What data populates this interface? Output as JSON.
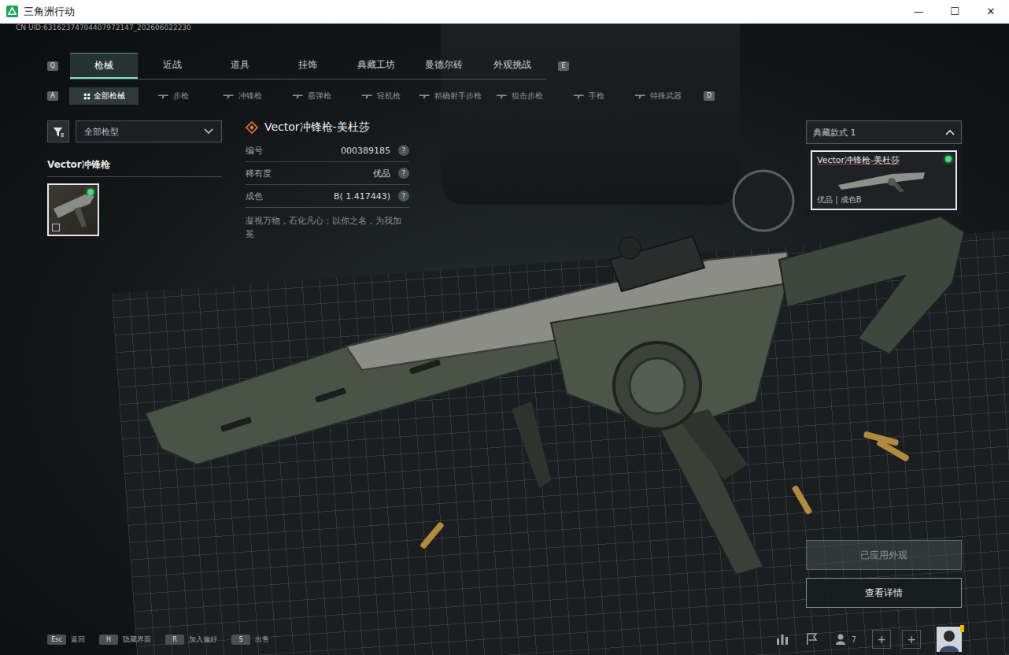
{
  "window": {
    "title": "三角洲行动",
    "controls": [
      "—",
      "☐",
      "✕"
    ]
  },
  "uid": "CN UID:63162374704407972147_202606022230",
  "top_tabs": {
    "prev_key": "Q",
    "next_key": "E",
    "tabs": [
      {
        "label": "枪械",
        "selected": true
      },
      {
        "label": "近战",
        "selected": false
      },
      {
        "label": "道具",
        "selected": false
      },
      {
        "label": "挂饰",
        "selected": false
      },
      {
        "label": "典藏工坊",
        "selected": false
      },
      {
        "label": "曼德尔砖",
        "selected": false
      },
      {
        "label": "外观挑战",
        "selected": false
      }
    ]
  },
  "sub_tabs": {
    "prev_key": "A",
    "next_key": "D",
    "tabs": [
      {
        "label": "全部枪械",
        "selected": true
      },
      {
        "label": "步枪",
        "selected": false
      },
      {
        "label": "冲锋枪",
        "selected": false
      },
      {
        "label": "霰弹枪",
        "selected": false
      },
      {
        "label": "轻机枪",
        "selected": false
      },
      {
        "label": "精确射手步枪",
        "selected": false
      },
      {
        "label": "狙击步枪",
        "selected": false
      },
      {
        "label": "手枪",
        "selected": false
      },
      {
        "label": "特殊武器",
        "selected": false
      }
    ]
  },
  "filter": {
    "value": "全部枪型"
  },
  "weapon_list": {
    "group": "Vector冲锋枪",
    "items": [
      {
        "equipped": true,
        "selected": true
      }
    ]
  },
  "detail": {
    "title": "Vector冲锋枪-美杜莎",
    "rows": [
      {
        "label": "编号",
        "value": "000389185",
        "help": "?"
      },
      {
        "label": "稀有度",
        "value": "优品",
        "help": "?"
      },
      {
        "label": "成色",
        "value": "B( 1.417443)",
        "help": "?"
      }
    ],
    "description": "凝视万物，石化凡心；以你之名，为我加冕"
  },
  "style_picker": {
    "label": "典藏款式 1",
    "expanded": true,
    "items": [
      {
        "name": "Vector冲锋枪-美杜莎",
        "info": "优品 | 成色B",
        "equipped": true,
        "selected": true
      }
    ]
  },
  "buttons": [
    {
      "label": "已应用外观",
      "disabled": true
    },
    {
      "label": "查看详情",
      "disabled": false
    }
  ],
  "key_hints": [
    {
      "key": "Esc",
      "label": "返回"
    },
    {
      "key": "H",
      "label": "隐藏界面"
    },
    {
      "key": "R",
      "label": "加入偏好"
    },
    {
      "key": "S",
      "label": "出售"
    }
  ],
  "footer": {
    "friends_count": "7",
    "add_buttons": [
      "+",
      "+"
    ],
    "avatar_badge": true
  }
}
